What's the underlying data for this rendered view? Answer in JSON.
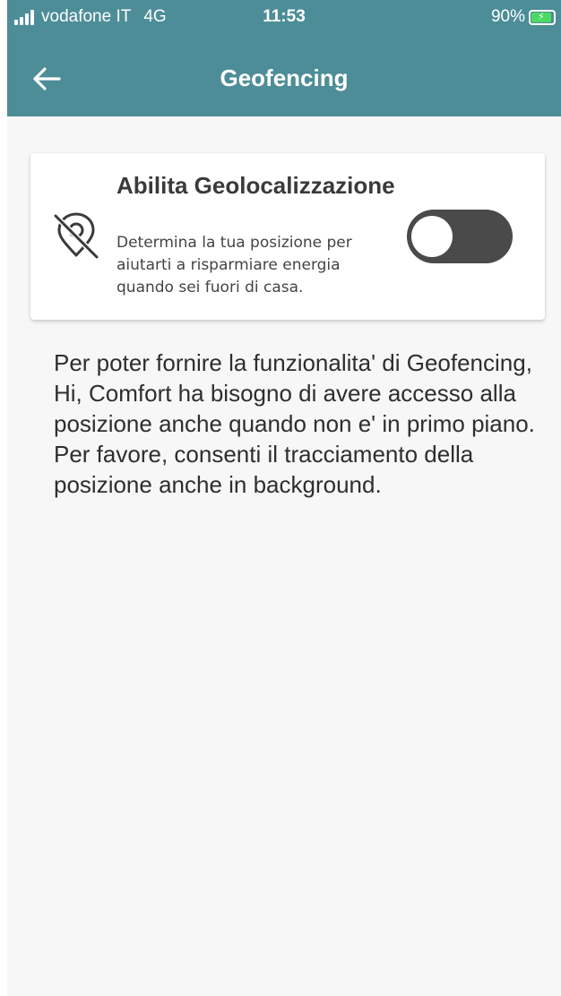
{
  "status_bar": {
    "carrier": "vodafone IT",
    "network": "4G",
    "time": "11:53",
    "battery_percent": "90%",
    "battery_level": 0.9,
    "battery_color": "#4cd964"
  },
  "app_bar": {
    "back_icon": "arrow-left-icon",
    "title": "Geofencing",
    "color": "#4d8d98"
  },
  "geolocation_card": {
    "icon": "location-off-icon",
    "title": "Abilita Geolocalizzazione",
    "description": "Determina la tua posizione per aiutarti a risparmiare energia quando sei fuori di casa.",
    "toggle_on": false,
    "toggle_color": "#4a4a4a"
  },
  "info_text": "Per poter fornire la funzionalita' di Geofencing, Hi, Comfort ha bisogno di avere accesso alla posizione anche quando non e' in primo piano. Per favore, consenti il tracciamento della posizione anche in background."
}
